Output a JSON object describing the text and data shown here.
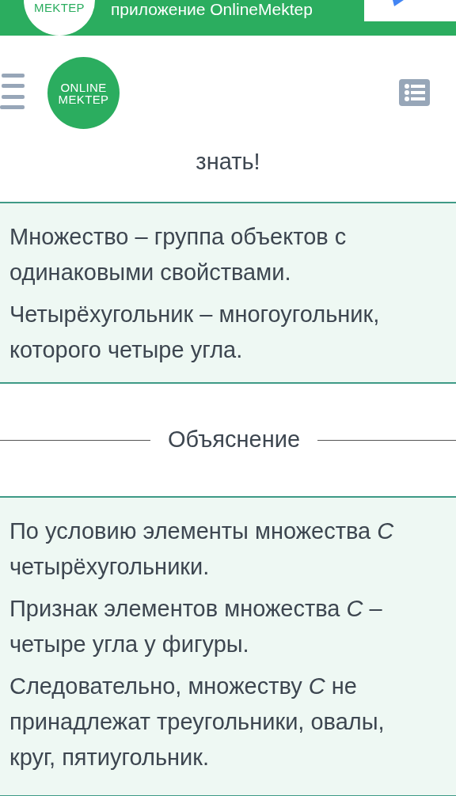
{
  "banner": {
    "logo_text": "MEKTEP",
    "text": "приложение OnlineMektep"
  },
  "header": {
    "logo_lines": [
      "ONLINE",
      "MEKTEP"
    ]
  },
  "heading_tail": "знать!",
  "definitions": [
    "Множество – группа объектов с\nодинаковыми свойствами.",
    "Четырёхугольник – многоугольник,\nкоторого четыре угла."
  ],
  "divider_label": "Объяснение",
  "explanation": [
    "По условию элементы множества *C*\nчетырёхугольники.",
    "Признак элементов множества *C* –\nчетыре угла у фигуры.",
    "Следовательно, множеству *C* не\nпринадлежат треугольники, овалы,\nкруг, пятиугольник."
  ]
}
